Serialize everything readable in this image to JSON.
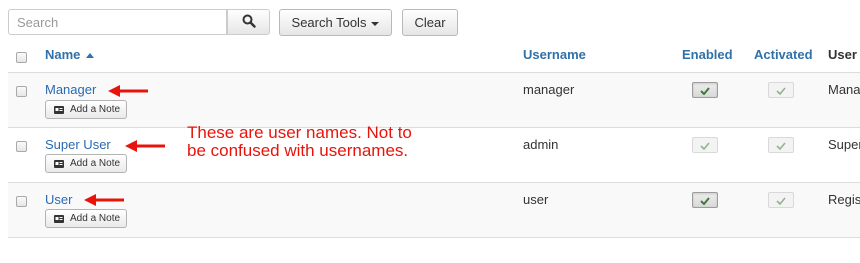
{
  "toolbar": {
    "search_placeholder": "Search",
    "search_tools_label": "Search Tools",
    "clear_label": "Clear"
  },
  "table": {
    "columns": {
      "name": "Name",
      "username": "Username",
      "enabled": "Enabled",
      "activated": "Activated",
      "user_groups": "User"
    },
    "rows": [
      {
        "name": "Manager",
        "note": "Add a Note",
        "username": "manager",
        "enabled": true,
        "activated": true,
        "group": "Mana"
      },
      {
        "name": "Super User",
        "note": "Add a Note",
        "username": "admin",
        "enabled": true,
        "activated": true,
        "group": "Super"
      },
      {
        "name": "User",
        "note": "Add a Note",
        "username": "user",
        "enabled": true,
        "activated": true,
        "group": "Regis"
      }
    ]
  },
  "annotation": {
    "text": "These are user names. Not to be confused with usernames.",
    "color": "#e8140c"
  },
  "icons": {
    "search": "search-icon",
    "sort": "sort-ascending-icon",
    "note": "note-icon",
    "check": "check-icon",
    "arrow": "arrow-left-icon"
  },
  "colors": {
    "link": "#2a6ab0",
    "header": "#3071a9",
    "check": "#3f7a3f"
  }
}
